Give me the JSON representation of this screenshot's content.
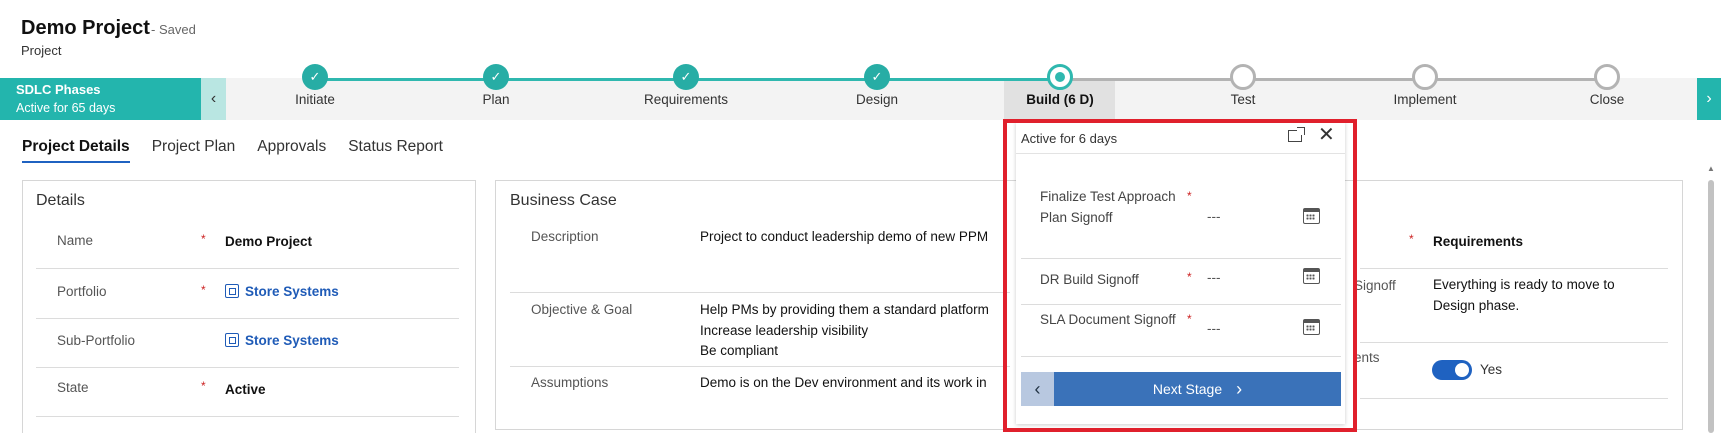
{
  "header": {
    "title": "Demo Project",
    "saved": "- Saved",
    "entity": "Project"
  },
  "process": {
    "phase_title": "SDLC Phases",
    "phase_sub": "Active for 65 days",
    "nav_left": "‹",
    "nav_right": "›",
    "stages": [
      {
        "label": "Initiate",
        "status": "done"
      },
      {
        "label": "Plan",
        "status": "done"
      },
      {
        "label": "Requirements",
        "status": "done"
      },
      {
        "label": "Design",
        "status": "done"
      },
      {
        "label": "Build  (6 D)",
        "status": "active"
      },
      {
        "label": "Test",
        "status": "todo"
      },
      {
        "label": "Implement",
        "status": "todo"
      },
      {
        "label": "Close",
        "status": "todo"
      }
    ],
    "check_glyph": "✓"
  },
  "tabs": [
    "Project Details",
    "Project Plan",
    "Approvals",
    "Status Report"
  ],
  "details": {
    "title": "Details",
    "rows": [
      {
        "label": "Name",
        "value": "Demo Project"
      },
      {
        "label": "Portfolio",
        "value": "Store Systems"
      },
      {
        "label": "Sub-Portfolio",
        "value": "Store Systems"
      },
      {
        "label": "State",
        "value": "Active"
      }
    ]
  },
  "business_case": {
    "title": "Business Case",
    "description_label": "Description",
    "description": "Project to conduct leadership demo of new PPM",
    "objective_label": "Objective & Goal",
    "objective_lines": [
      "Help PMs by providing them a standard platform",
      "Increase leadership visibility",
      "Be compliant"
    ],
    "assumptions_label": "Assumptions",
    "assumptions": "Demo is on the Dev environment and its work in"
  },
  "right_card": {
    "value1": "Requirements",
    "label2": "Signoff",
    "value2": "Everything is ready to move to Design phase.",
    "label3": "ents",
    "toggle_label": "Yes",
    "toggle_on": true
  },
  "flyout": {
    "header": "Active for 6 days",
    "close": "✕",
    "fields": [
      {
        "label": "Finalize Test Approach Plan Signoff",
        "value": "---"
      },
      {
        "label": "DR Build Signoff",
        "value": "---"
      },
      {
        "label": "SLA Document Signoff",
        "value": "---"
      }
    ],
    "back": "‹",
    "next_label": "Next Stage",
    "next_chev": "›"
  },
  "colors": {
    "teal": "#23b5ad",
    "blue": "#3a72b9",
    "highlight": "#e0202c",
    "link": "#1f5bb7"
  }
}
